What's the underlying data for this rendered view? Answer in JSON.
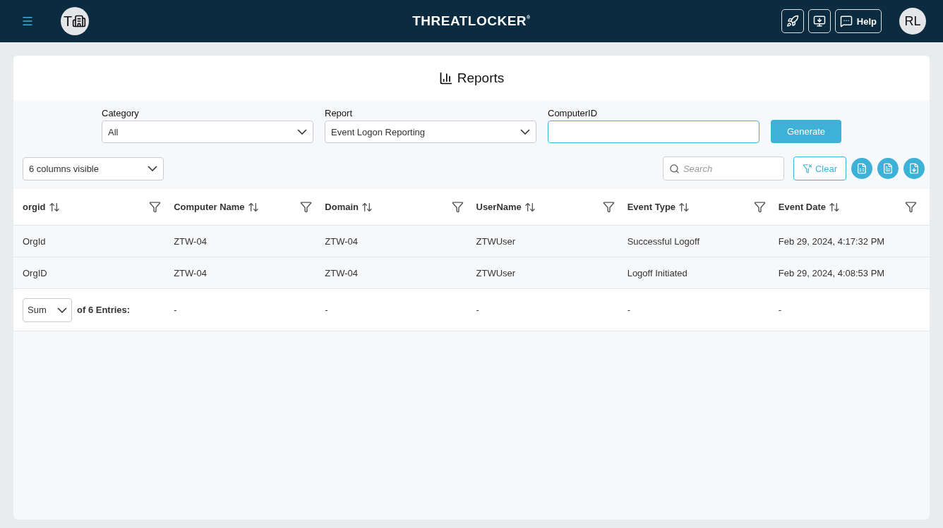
{
  "header": {
    "org_initial": "T",
    "logo": "THREATLOCKER",
    "logo_mark": "®",
    "help": "Help",
    "user_initials": "RL"
  },
  "page_title": "Reports",
  "filters": [
    {
      "label": "Category",
      "value": "All",
      "kind": "select"
    },
    {
      "label": "Report",
      "value": "Event Logon Reporting",
      "kind": "select"
    },
    {
      "label": "ComputerID",
      "kind": "text",
      "focused": true
    }
  ],
  "generate": "Generate",
  "columns_visible": "6 columns visible",
  "search": {
    "placeholder": "Search"
  },
  "clear": "Clear",
  "table": {
    "columns": [
      "orgid",
      "Computer Name",
      "Domain",
      "UserName",
      "Event Type",
      "Event Date"
    ],
    "rows": [
      [
        "OrgId",
        "ZTW-04",
        "ZTW-04",
        "ZTWUser",
        "Successful Logoff",
        "Feb 29, 2024, 4:17:32 PM"
      ],
      [
        "OrgID",
        "ZTW-04",
        "ZTW-04",
        "ZTWUser",
        "Logoff Initiated",
        "Feb 29, 2024, 4:08:53 PM"
      ]
    ],
    "footer": {
      "aggregate": "Sum",
      "label": "of 6 Entries:",
      "cells": [
        "-",
        "-",
        "-",
        "-",
        "-"
      ]
    }
  }
}
